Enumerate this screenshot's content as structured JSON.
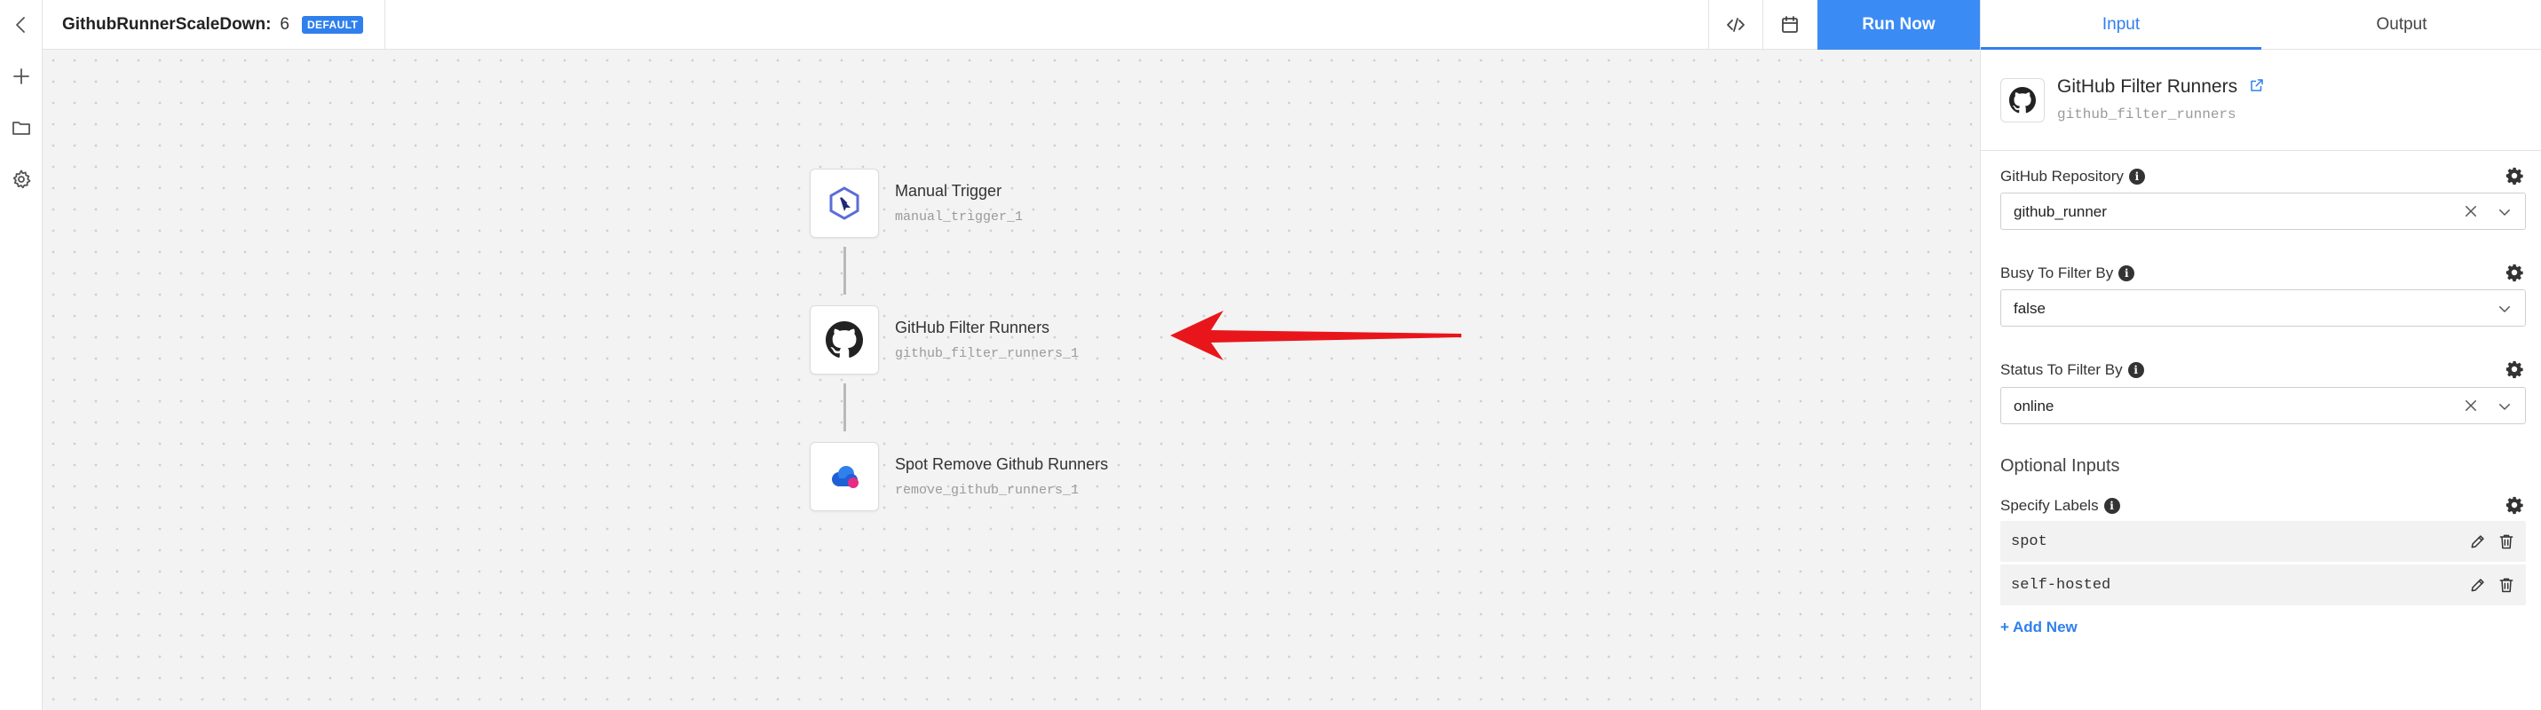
{
  "colors": {
    "accent": "#2f80ed",
    "run_button": "#3b8bf5",
    "arrow": "#e8161b",
    "canvas_bg": "#f3f3f3"
  },
  "rail": {
    "icons": [
      "back-chevron-icon",
      "plus-icon",
      "folder-icon",
      "gear-icon"
    ]
  },
  "topbar": {
    "workflow_name": "GithubRunnerScaleDown:",
    "version": "6",
    "badge": "DEFAULT",
    "code_icon": "code-icon",
    "calendar_icon": "calendar-icon",
    "run_label": "Run Now"
  },
  "canvas": {
    "nodes": [
      {
        "name": "Manual Trigger",
        "id": "manual_trigger_1",
        "icon": "cursor-hexagon-icon"
      },
      {
        "name": "GitHub Filter Runners",
        "id": "github_filter_runners_1",
        "icon": "github-icon"
      },
      {
        "name": "Spot Remove Github Runners",
        "id": "remove_github_runners_1",
        "icon": "spot-cloud-icon"
      }
    ],
    "annotation": "red-arrow-pointing-left"
  },
  "panel": {
    "tabs": [
      {
        "label": "Input",
        "active": true
      },
      {
        "label": "Output",
        "active": false
      }
    ],
    "node": {
      "name": "GitHub Filter Runners",
      "id": "github_filter_runners"
    },
    "fields": [
      {
        "label": "GitHub Repository",
        "value": "github_runner",
        "clearable": true
      },
      {
        "label": "Busy To Filter By",
        "value": "false",
        "clearable": false
      },
      {
        "label": "Status To Filter By",
        "value": "online",
        "clearable": true
      }
    ],
    "optional_heading": "Optional Inputs",
    "labels_field": {
      "label": "Specify Labels",
      "items": [
        "spot",
        "self-hosted"
      ]
    },
    "add_new": "+ Add New"
  }
}
